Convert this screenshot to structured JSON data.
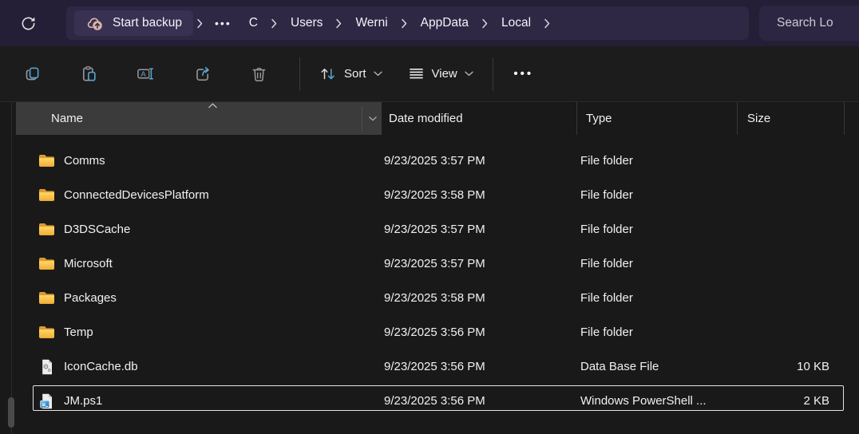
{
  "titlebar": {
    "backup_label": "Start backup",
    "overflow_label": "•••",
    "breadcrumbs": [
      "C",
      "Users",
      "Werni",
      "AppData",
      "Local"
    ],
    "search_placeholder": "Search Lo"
  },
  "toolbar": {
    "sort_label": "Sort",
    "view_label": "View",
    "more_label": "•••"
  },
  "columns": {
    "name": "Name",
    "date": "Date modified",
    "type": "Type",
    "size": "Size"
  },
  "files": [
    {
      "name": "Comms",
      "icon": "folder",
      "date_modified": "9/23/2025 3:57 PM",
      "type": "File folder",
      "size": ""
    },
    {
      "name": "ConnectedDevicesPlatform",
      "icon": "folder",
      "date_modified": "9/23/2025 3:58 PM",
      "type": "File folder",
      "size": ""
    },
    {
      "name": "D3DSCache",
      "icon": "folder",
      "date_modified": "9/23/2025 3:57 PM",
      "type": "File folder",
      "size": ""
    },
    {
      "name": "Microsoft",
      "icon": "folder",
      "date_modified": "9/23/2025 3:57 PM",
      "type": "File folder",
      "size": ""
    },
    {
      "name": "Packages",
      "icon": "folder",
      "date_modified": "9/23/2025 3:58 PM",
      "type": "File folder",
      "size": ""
    },
    {
      "name": "Temp",
      "icon": "folder",
      "date_modified": "9/23/2025 3:56 PM",
      "type": "File folder",
      "size": ""
    },
    {
      "name": "IconCache.db",
      "icon": "database-file",
      "date_modified": "9/23/2025 3:56 PM",
      "type": "Data Base File",
      "size": "10 KB"
    },
    {
      "name": "JM.ps1",
      "icon": "powershell-file",
      "date_modified": "9/23/2025 3:56 PM",
      "type": "Windows PowerShell ...",
      "size": "2 KB",
      "selected": true
    }
  ],
  "colors": {
    "titlebar_bg": "#241f36",
    "address_pill_bg": "#2e2845",
    "backup_segment_bg": "#383152",
    "toolbar_bg": "#1c1c1c",
    "list_bg": "#191919",
    "header_hover_bg": "#3b3b3b",
    "accent_blue": "#58a6d8",
    "folder_yellow": "#f6c447",
    "cloud_pink": "#dcb4a9",
    "selection_border": "#e4e4e4"
  }
}
